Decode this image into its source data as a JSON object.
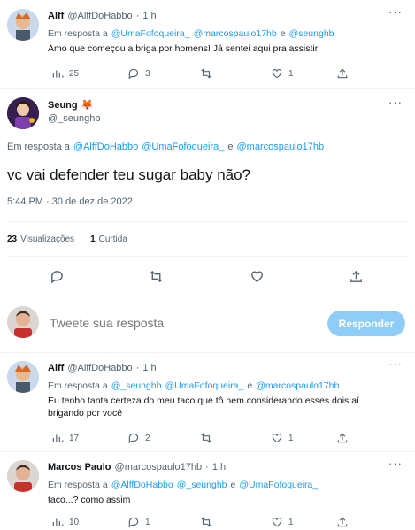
{
  "tweet1": {
    "name": "Alff",
    "handle": "@AlffDoHabbo",
    "dot": "·",
    "time": "1 h",
    "reply_prefix": "Em resposta a",
    "mentions": [
      "@UmaFofoqueira_",
      "@marcospaulo17hb",
      "@seunghb"
    ],
    "conj": "e",
    "text": "Amo que começou a briga por homens! Já sentei aqui pra assistir",
    "views": "25",
    "replies": "3",
    "retweets": "",
    "likes": "1"
  },
  "main": {
    "name": "Seung",
    "emoji": "🦊",
    "handle": "@_seunghb",
    "reply_prefix": "Em resposta a",
    "mentions": [
      "@AlffDoHabbo",
      "@UmaFofoqueira_",
      "@marcospaulo17hb"
    ],
    "conj": "e",
    "text": "vc vai defender teu sugar baby não?",
    "timestamp": "5:44 PM · 30 de dez de 2022",
    "views_count": "23",
    "views_label": "Visualizações",
    "likes_count": "1",
    "likes_label": "Curtida"
  },
  "compose": {
    "placeholder": "Tweete sua resposta",
    "button": "Responder"
  },
  "tweet2": {
    "name": "Alff",
    "handle": "@AlffDoHabbo",
    "dot": "·",
    "time": "1 h",
    "reply_prefix": "Em resposta a",
    "mentions": [
      "@_seunghb",
      "@UmaFofoqueira_",
      "@marcospaulo17hb"
    ],
    "conj": "e",
    "text_line1": "Eu tenho tanta certeza do meu taco que tô nem considerando esses dois aí",
    "text_line2": "brigando por você",
    "views": "17",
    "replies": "2",
    "likes": "1"
  },
  "tweet3": {
    "name": "Marcos Paulo",
    "handle": "@marcospaulo17hb",
    "dot": "·",
    "time": "1 h",
    "reply_prefix": "Em resposta a",
    "mentions": [
      "@AlffDoHabbo",
      "@_seunghb",
      "@UmaFofoqueira_"
    ],
    "conj": "e",
    "text": "taco...? como assim",
    "views": "10",
    "replies": "1",
    "likes": "1"
  }
}
